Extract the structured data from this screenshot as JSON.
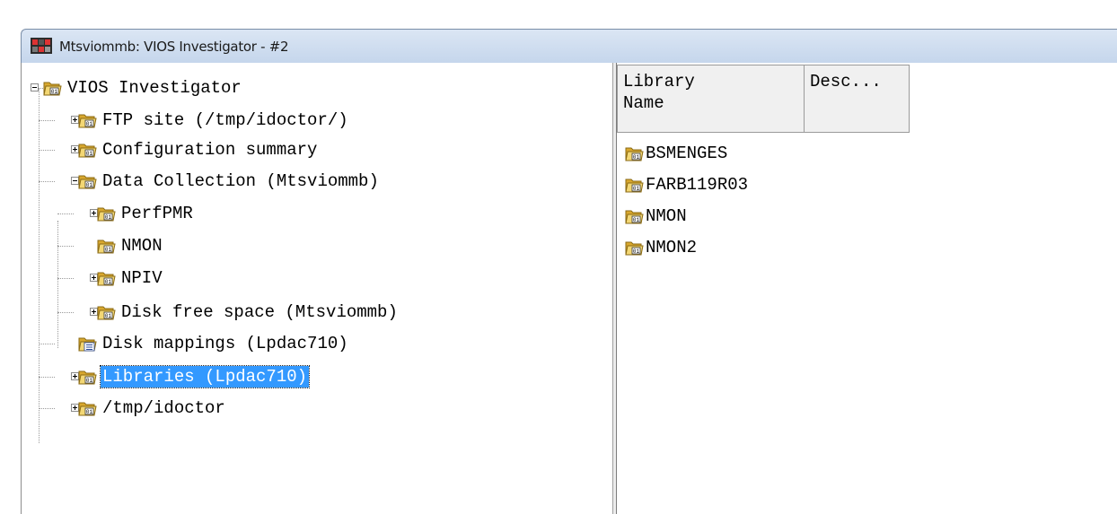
{
  "window": {
    "title": "Mtsviommb: VIOS Investigator - #2",
    "icon": "app-icon"
  },
  "tree": {
    "root": {
      "label": "VIOS Investigator",
      "icon": "folder-icon"
    },
    "items": [
      {
        "label": "FTP site (/tmp/idoctor/)",
        "icon": "folder-icon"
      },
      {
        "label": "Configuration summary",
        "icon": "folder-icon"
      },
      {
        "label": "Data Collection (Mtsviommb)",
        "icon": "folder-icon"
      },
      {
        "label": "PerfPMR",
        "icon": "folder-icon"
      },
      {
        "label": "NMON",
        "icon": "folder-icon"
      },
      {
        "label": "NPIV",
        "icon": "folder-icon"
      },
      {
        "label": "Disk free space (Mtsviommb)",
        "icon": "folder-icon"
      },
      {
        "label": "Disk mappings (Lpdac710)",
        "icon": "report-icon"
      },
      {
        "label": "Libraries (Lpdac710)",
        "icon": "folder-icon",
        "selected": true
      },
      {
        "label": "/tmp/idoctor",
        "icon": "folder-icon"
      }
    ]
  },
  "list": {
    "columns": [
      {
        "label": "Library\nName"
      },
      {
        "label": "Desc..."
      }
    ],
    "items": [
      {
        "name": "BSMENGES"
      },
      {
        "name": "FARB119R03"
      },
      {
        "name": "NMON"
      },
      {
        "name": "NMON2"
      }
    ]
  },
  "colors": {
    "selection": "#3399ff",
    "titlebar": "#c5d6ec",
    "folder": "#e8c45a"
  }
}
